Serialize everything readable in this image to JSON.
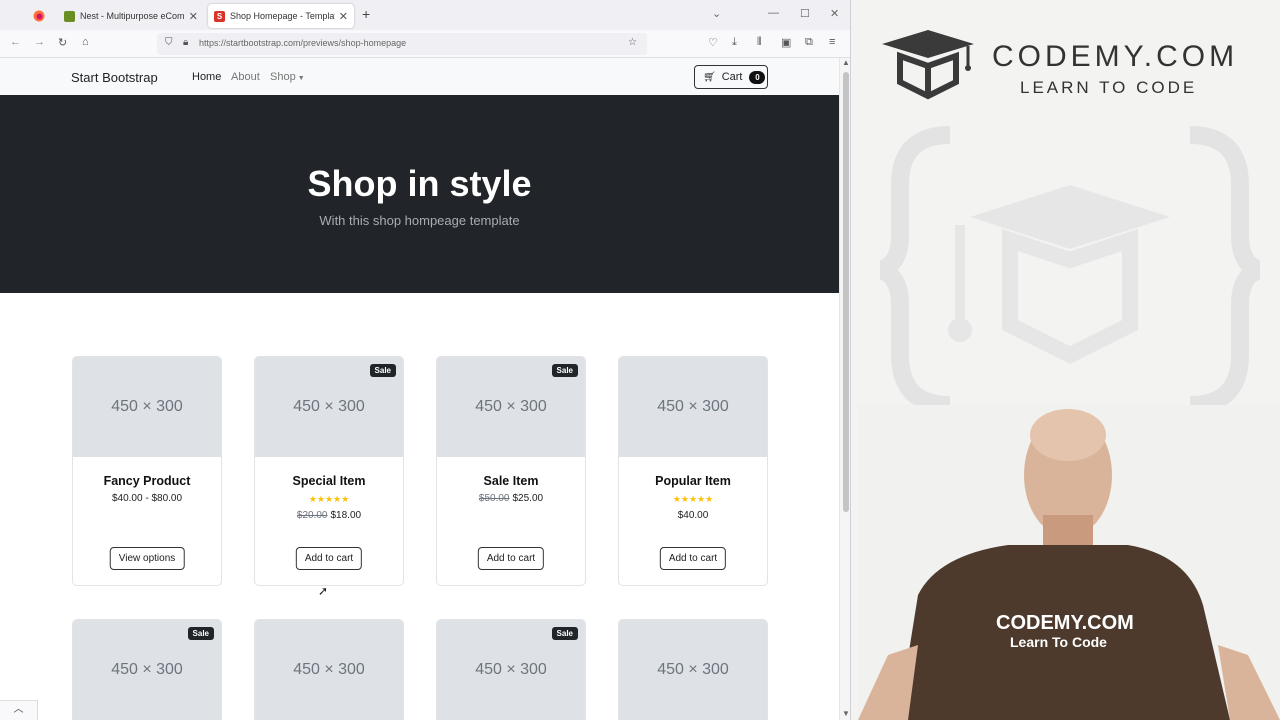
{
  "browser": {
    "tabs": [
      {
        "title": "Nest - Multipurpose eCommerce"
      },
      {
        "title": "Shop Homepage - Template Preview",
        "favicon_letter": "S"
      }
    ],
    "url": "https://startbootstrap.com/previews/shop-homepage"
  },
  "site": {
    "brand": "Start Bootstrap",
    "nav": {
      "home": "Home",
      "about": "About",
      "shop": "Shop"
    },
    "cart": {
      "label": "Cart",
      "count": "0"
    }
  },
  "hero": {
    "title": "Shop in style",
    "subtitle": "With this shop hompeage template"
  },
  "products": [
    {
      "image": "450 × 300",
      "name": "Fancy Product",
      "price": "$40.00 - $80.00",
      "action": "View options",
      "sale": "",
      "rating": 0
    },
    {
      "image": "450 × 300",
      "name": "Special Item",
      "old_price": "$20.00",
      "price": "$18.00",
      "action": "Add to cart",
      "sale": "Sale",
      "rating": 5
    },
    {
      "image": "450 × 300",
      "name": "Sale Item",
      "old_price": "$50.00",
      "price": "$25.00",
      "action": "Add to cart",
      "sale": "Sale",
      "rating": 0
    },
    {
      "image": "450 × 300",
      "name": "Popular Item",
      "price": "$40.00",
      "action": "Add to cart",
      "sale": "",
      "rating": 5
    }
  ],
  "products_row2": [
    {
      "image": "450 × 300",
      "sale": "Sale"
    },
    {
      "image": "450 × 300",
      "sale": ""
    },
    {
      "image": "450 × 300",
      "sale": "Sale"
    },
    {
      "image": "450 × 300",
      "sale": ""
    }
  ],
  "branding": {
    "logo_line1": "CODEMY.COM",
    "logo_line2": "LEARN TO CODE",
    "shirt_line1": "CODEMY.COM",
    "shirt_line2": "Learn To Code"
  },
  "colors": {
    "hero_bg": "#212529",
    "star": "#ffc107",
    "placeholder": "#dee2e6"
  }
}
